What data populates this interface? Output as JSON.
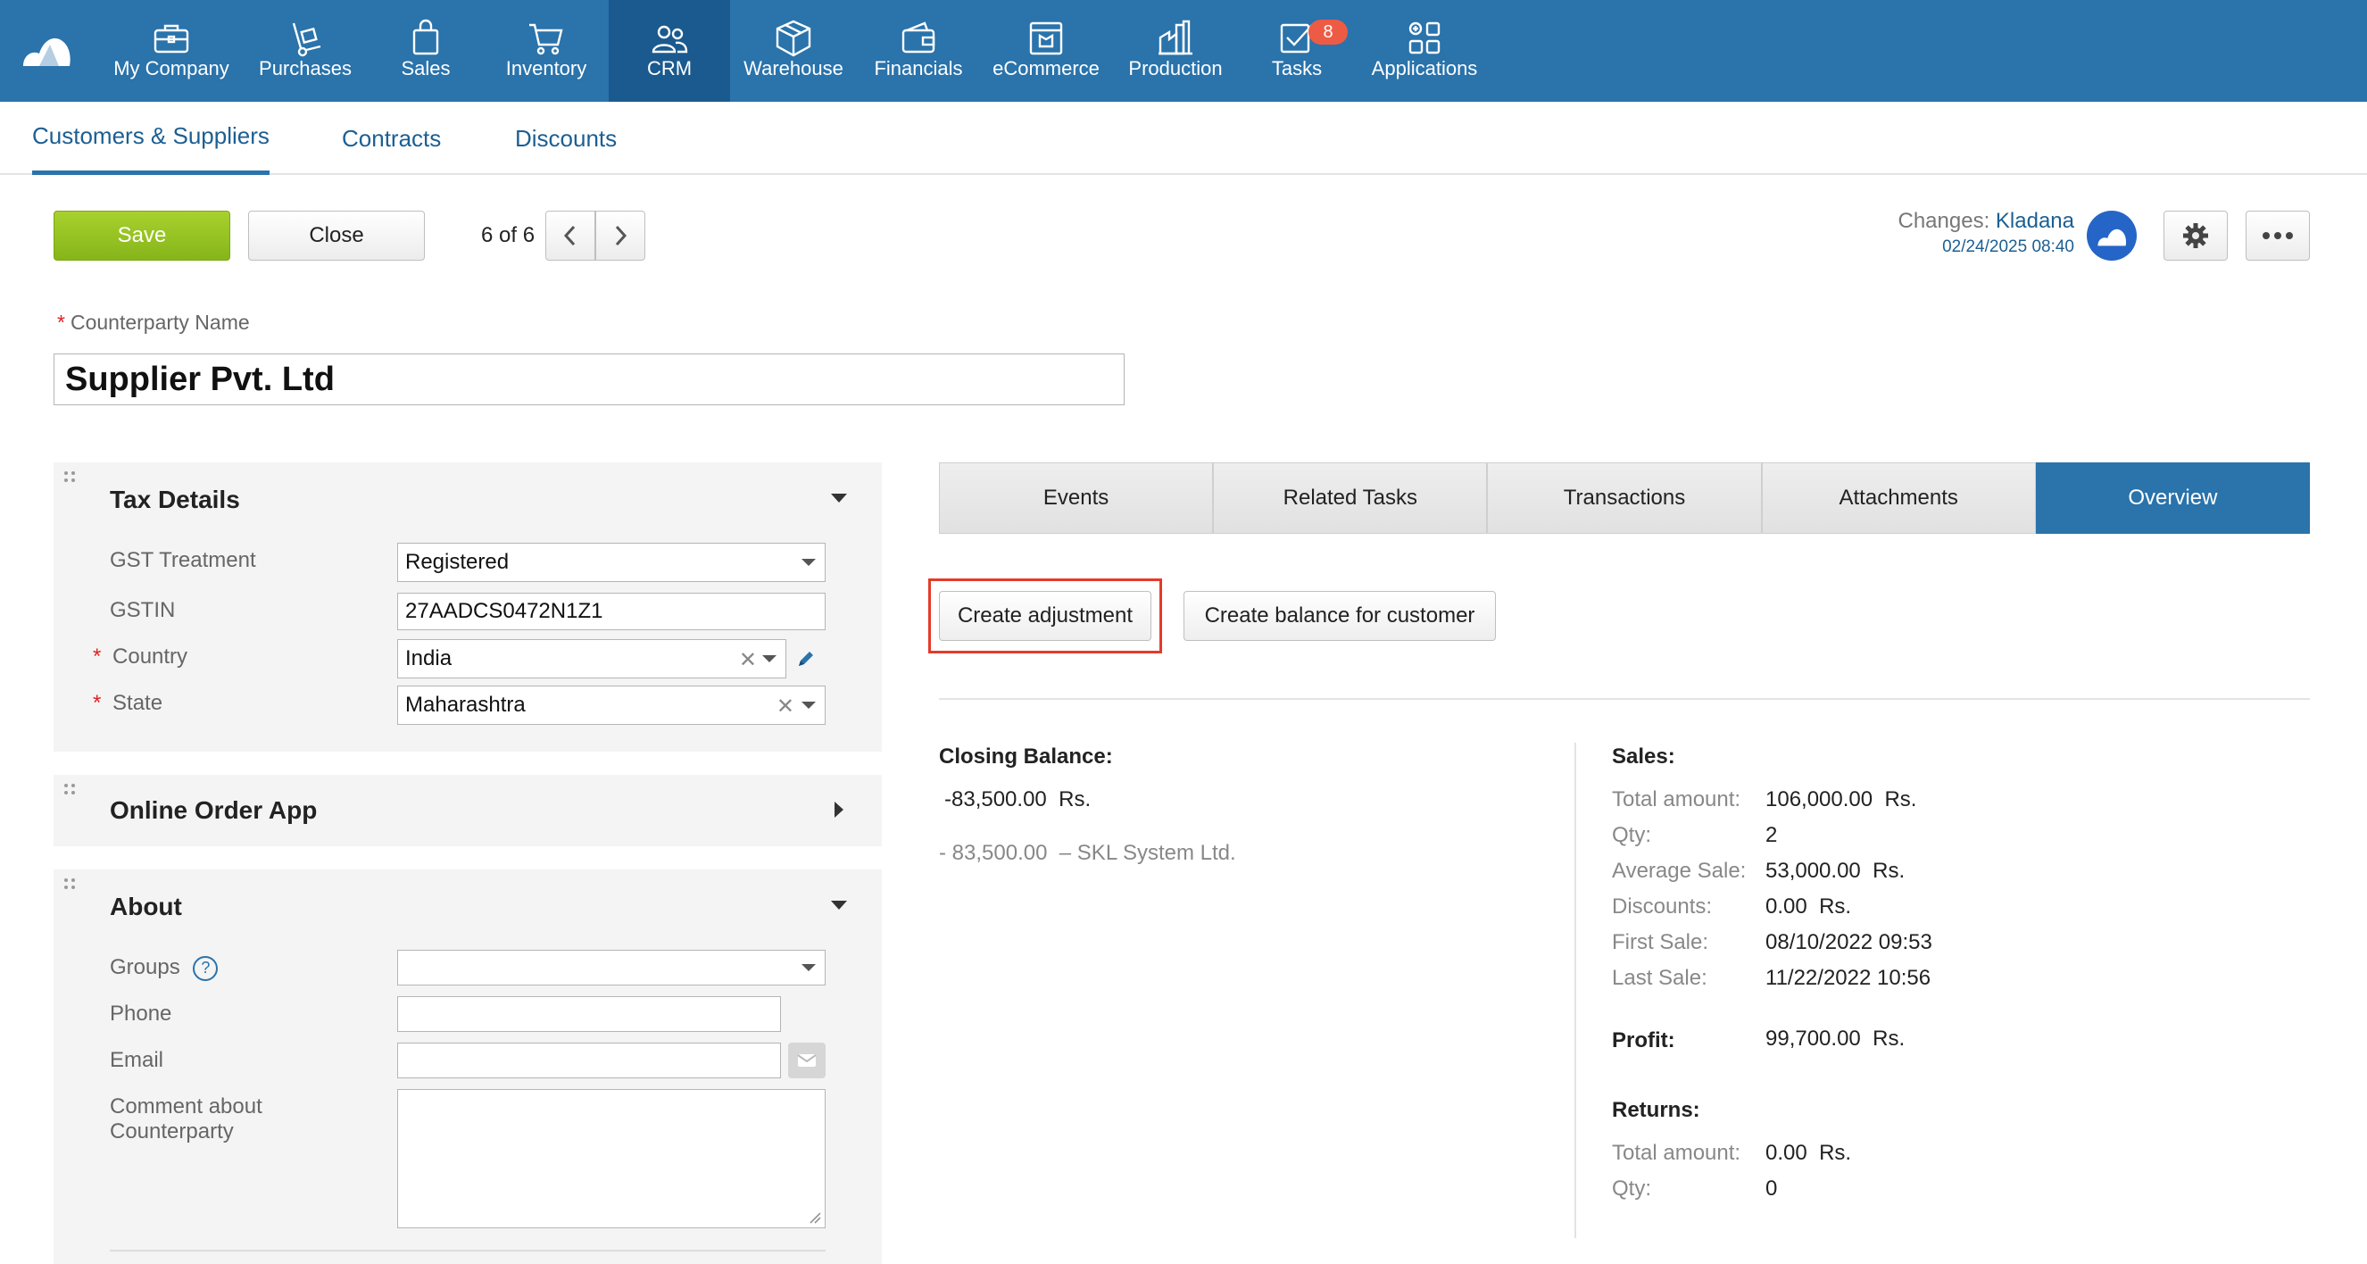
{
  "nav": {
    "items": [
      {
        "label": "My Company",
        "icon": "briefcase-icon"
      },
      {
        "label": "Purchases",
        "icon": "hand-truck-icon"
      },
      {
        "label": "Sales",
        "icon": "shopping-bag-icon"
      },
      {
        "label": "Inventory",
        "icon": "cart-icon"
      },
      {
        "label": "CRM",
        "icon": "people-icon"
      },
      {
        "label": "Warehouse",
        "icon": "box-icon"
      },
      {
        "label": "Financials",
        "icon": "wallet-icon"
      },
      {
        "label": "eCommerce",
        "icon": "storefront-icon"
      },
      {
        "label": "Production",
        "icon": "factory-icon"
      },
      {
        "label": "Tasks",
        "icon": "checkbox-icon",
        "badge": "8"
      },
      {
        "label": "Applications",
        "icon": "apps-grid-icon"
      }
    ],
    "active": "CRM"
  },
  "subnav": {
    "tabs": [
      "Customers & Suppliers",
      "Contracts",
      "Discounts"
    ],
    "active": "Customers & Suppliers"
  },
  "toolbar": {
    "save_label": "Save",
    "close_label": "Close",
    "pager": "6 of 6",
    "changes_label": "Changes:",
    "changes_user": "Kladana",
    "changes_date": "02/24/2025 08:40"
  },
  "counterparty": {
    "label": "Counterparty Name",
    "name": "Supplier Pvt. Ltd"
  },
  "tax_details": {
    "title": "Tax Details",
    "gst_treatment_label": "GST Treatment",
    "gst_treatment_value": "Registered",
    "gstin_label": "GSTIN",
    "gstin_value": "27AADCS0472N1Z1",
    "country_label": "Country",
    "country_value": "India",
    "state_label": "State",
    "state_value": "Maharashtra"
  },
  "online_order": {
    "title": "Online Order App"
  },
  "about": {
    "title": "About",
    "groups_label": "Groups",
    "groups_help": "?",
    "phone_label": "Phone",
    "email_label": "Email",
    "comment_label_1": "Comment about",
    "comment_label_2": "Counterparty"
  },
  "tabs": {
    "items": [
      "Events",
      "Related Tasks",
      "Transactions",
      "Attachments",
      "Overview"
    ],
    "active": "Overview"
  },
  "actions": {
    "create_adjustment": "Create adjustment",
    "create_balance": "Create balance for customer"
  },
  "closing": {
    "title": "Closing Balance:",
    "amount": "-83,500.00",
    "currency": "Rs.",
    "detail_amount": "- 83,500.00",
    "detail_org": "– SKL System Ltd."
  },
  "sales": {
    "title": "Sales:",
    "rows": [
      {
        "label": "Total amount:",
        "value": "106,000.00",
        "unit": "Rs."
      },
      {
        "label": "Qty:",
        "value": "2",
        "unit": ""
      },
      {
        "label": "Average Sale:",
        "value": "53,000.00",
        "unit": "Rs."
      },
      {
        "label": "Discounts:",
        "value": "0.00",
        "unit": "Rs."
      },
      {
        "label": "First Sale:",
        "value": "08/10/2022 09:53",
        "unit": ""
      },
      {
        "label": "Last Sale:",
        "value": "11/22/2022 10:56",
        "unit": ""
      }
    ],
    "profit_label": "Profit:",
    "profit_value": "99,700.00",
    "profit_unit": "Rs."
  },
  "returns": {
    "title": "Returns:",
    "total_label": "Total amount:",
    "total_value": "0.00",
    "total_unit": "Rs.",
    "qty_label": "Qty:",
    "qty_value": "0"
  },
  "colors": {
    "nav_bg": "#2a73ab",
    "nav_active": "#1a5a8f",
    "save_green": "#96c322",
    "badge_red": "#ee5b44",
    "highlight_red": "#e53a2a"
  }
}
